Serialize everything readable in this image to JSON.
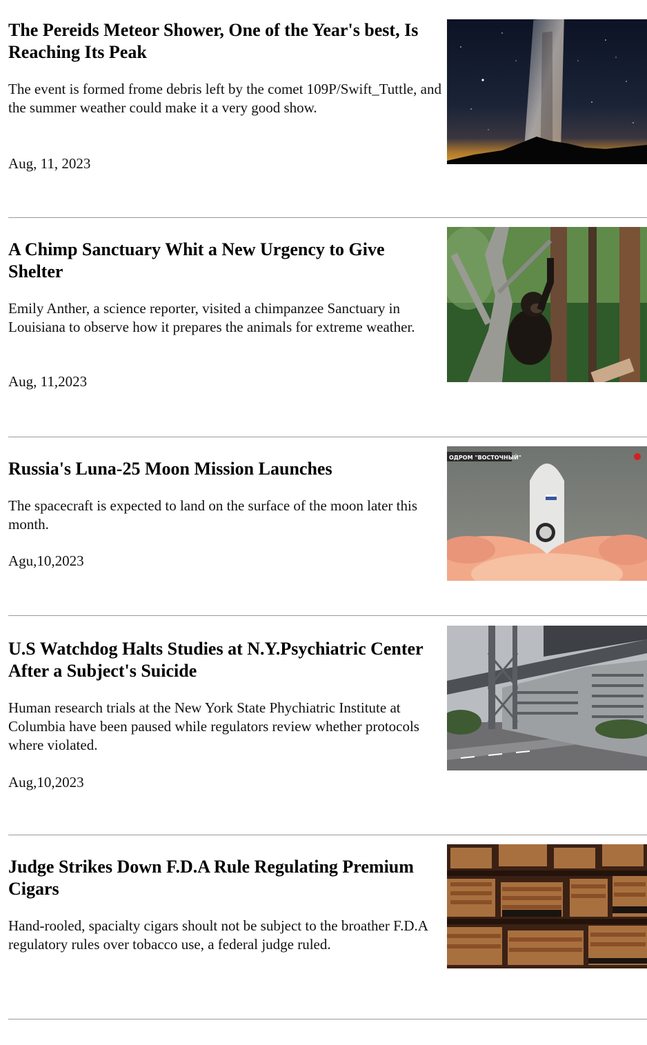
{
  "articles": [
    {
      "title": "The Pereids Meteor Shower, One of the Year's best, Is Reaching Its Peak",
      "summary": "The event is formed frome debris left by the comet 109P/Swift_Tuttle, and the summer weather could make it a very good show.",
      "date": "Aug, 11, 2023",
      "image": "milky-way-night-sky-photo"
    },
    {
      "title": "A Chimp Sanctuary Whit a New Urgency to Give Shelter",
      "summary": "Emily Anther, a science reporter, visited a chimpanzee Sanctuary in Louisiana to observe how it prepares the animals for extreme weather.",
      "date": "Aug, 11,2023",
      "image": "chimpanzee-in-tree-photo"
    },
    {
      "title": "Russia's Luna-25 Moon Mission Launches",
      "summary": "The spacecraft is expected to land on the surface of the moon later this month.",
      "date": "Agu,10,2023",
      "image": "rocket-launch-photo",
      "image_caption": "ОДРОМ \"ВОСТОЧНЫЙ\""
    },
    {
      "title": "U.S Watchdog Halts Studies at N.Y.Psychiatric Center After a Subject's Suicide",
      "summary": "Human research trials at the New York State Phychiatric Institute at Columbia have been paused while regulators review whether protocols where violated.",
      "date": "Aug,10,2023",
      "image": "institute-building-skybridge-photo"
    },
    {
      "title": "Judge Strikes Down F.D.A Rule Regulating Premium Cigars",
      "summary": "Hand-rooled, spacialty cigars shoult not be subject to the broather F.D.A regulatory rules over tobacco use, a federal judge ruled.",
      "date": "",
      "image": "cigar-boxes-display-photo"
    }
  ]
}
